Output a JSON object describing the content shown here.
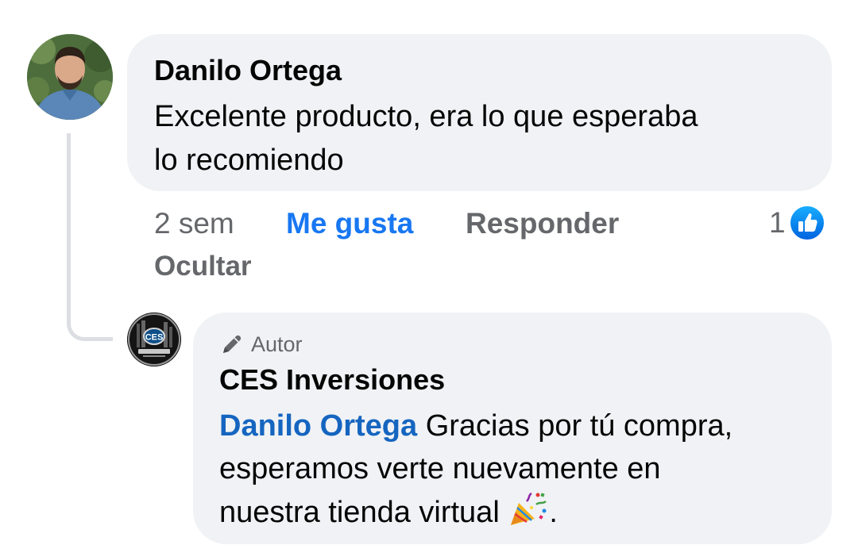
{
  "comment": {
    "author": "Danilo Ortega",
    "text_line1": "Excelente producto, era lo que esperaba",
    "text_line2": "lo recomiendo",
    "time": "2 sem",
    "like_label": "Me gusta",
    "reply_label": "Responder",
    "hide_label": "Ocultar",
    "reaction_count": "1"
  },
  "reply": {
    "badge_label": "Autor",
    "author": "CES Inversiones",
    "mention": "Danilo Ortega",
    "text_rest": " Gracias por tú compra,",
    "text_line2": "esperamos verte nuevamente en",
    "text_line3": "nuestra tienda virtual",
    "text_end": ".",
    "avatar_logo_text": "CES"
  },
  "colors": {
    "bubble": "#f0f2f5",
    "link_blue": "#1877f2",
    "mention_blue": "#1565c0",
    "secondary_text": "#65676b"
  },
  "icons": {
    "like_badge": "thumbs-up-icon",
    "author_badge": "pen-icon",
    "emoji": "party-popper-icon"
  }
}
